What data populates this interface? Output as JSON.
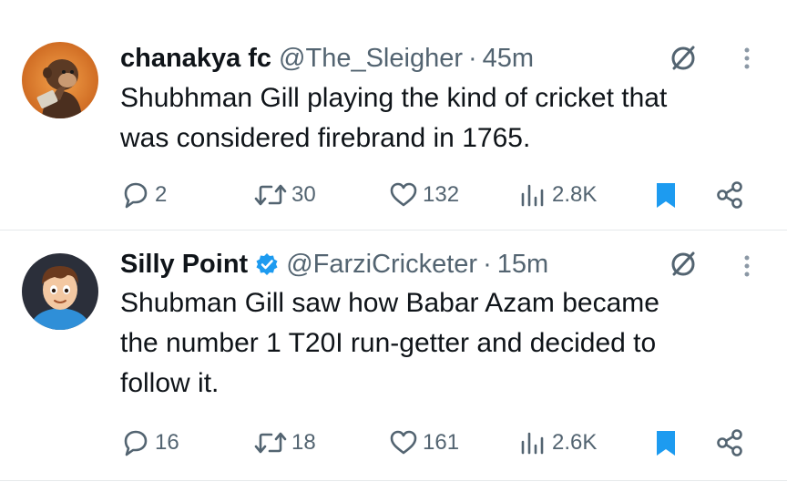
{
  "tweets": [
    {
      "name": "chanakya fc",
      "handle": "@The_Sleigher",
      "separator": "·",
      "time": "45m",
      "verified": false,
      "text_lines": [
        "Shubhman Gill playing the kind of cricket that",
        "was considered firebrand in 1765."
      ],
      "replies": "2",
      "reposts": "30",
      "likes": "132",
      "views": "2.8K",
      "avatar_icon": "monkey-thinking-avatar"
    },
    {
      "name": "Silly Point",
      "handle": "@FarziCricketer",
      "separator": "·",
      "time": "15m",
      "verified": true,
      "text_lines": [
        "Shubman Gill saw how Babar Azam became",
        "the number 1 T20I run-getter and decided to",
        "follow it."
      ],
      "replies": "16",
      "reposts": "18",
      "likes": "161",
      "views": "2.6K",
      "avatar_icon": "cartoon-boy-avatar"
    }
  ],
  "colors": {
    "text": "#0f1419",
    "muted": "#536471",
    "accent_blue": "#1d9bf0",
    "divider": "#e6e9eb"
  },
  "icons": [
    "reply-icon",
    "repost-icon",
    "like-icon",
    "views-icon",
    "bookmark-icon",
    "share-icon",
    "grok-icon",
    "more-icon",
    "verified-icon"
  ]
}
